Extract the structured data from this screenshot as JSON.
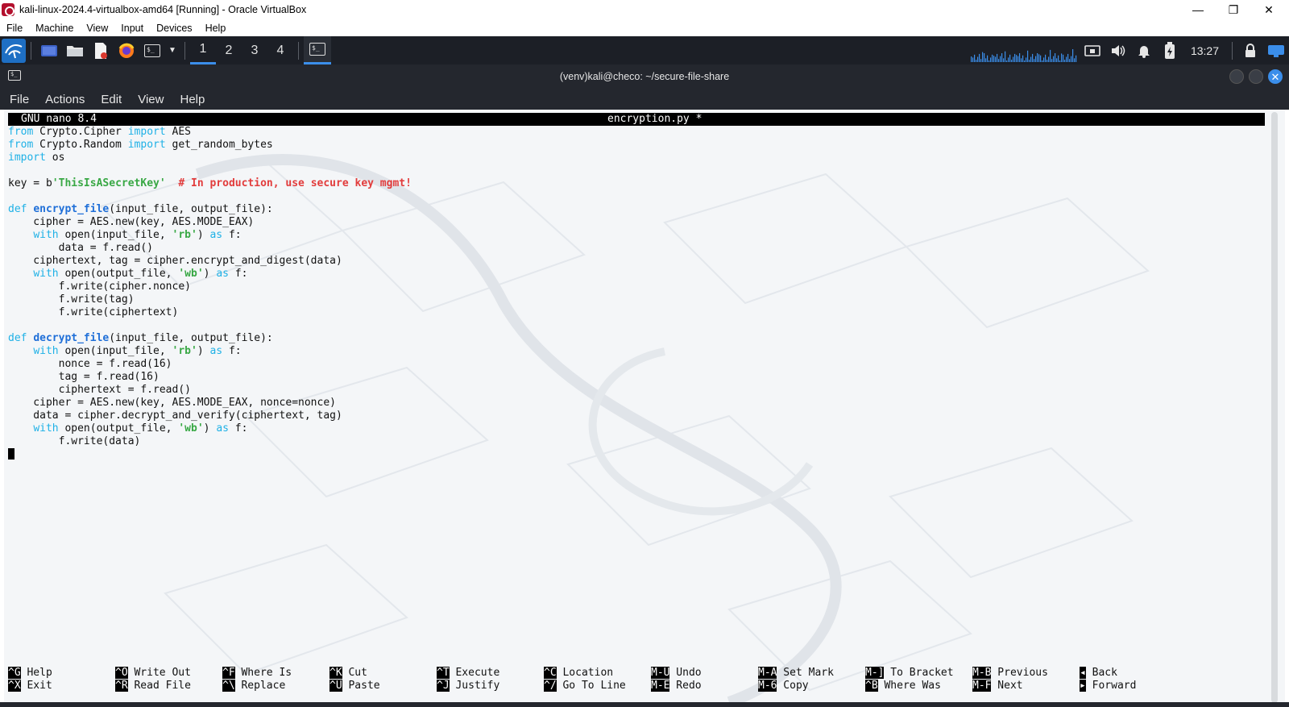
{
  "host_window": {
    "title": "kali-linux-2024.4-virtualbox-amd64 [Running] - Oracle VirtualBox",
    "controls": {
      "minimize": "—",
      "restore": "❐",
      "close": "✕"
    },
    "menu": [
      "File",
      "Machine",
      "View",
      "Input",
      "Devices",
      "Help"
    ]
  },
  "panel": {
    "workspaces": [
      "1",
      "2",
      "3",
      "4"
    ],
    "active_workspace": "1",
    "clock": "13:27",
    "icons": [
      "kali-menu-icon",
      "desktop-icon",
      "file-manager-icon",
      "text-editor-icon",
      "firefox-icon",
      "terminal-icon",
      "network-icon",
      "volume-icon",
      "notifications-icon",
      "battery-icon",
      "lock-icon",
      "vm-icon"
    ]
  },
  "terminal": {
    "title": "(venv)kali@checo: ~/secure-file-share",
    "menu": [
      "File",
      "Actions",
      "Edit",
      "View",
      "Help"
    ]
  },
  "nano": {
    "version": "GNU nano 8.4",
    "filename": "encryption.py *",
    "code_lines": [
      [
        {
          "t": "from",
          "c": "kw"
        },
        {
          "t": " Crypto.Cipher "
        },
        {
          "t": "import",
          "c": "kw"
        },
        {
          "t": " AES"
        }
      ],
      [
        {
          "t": "from",
          "c": "kw"
        },
        {
          "t": " Crypto.Random "
        },
        {
          "t": "import",
          "c": "kw"
        },
        {
          "t": " get_random_bytes"
        }
      ],
      [
        {
          "t": "import",
          "c": "kw"
        },
        {
          "t": " os"
        }
      ],
      [],
      [
        {
          "t": "key = b"
        },
        {
          "t": "'ThisIsASecretKey'",
          "c": "str"
        },
        {
          "t": "  "
        },
        {
          "t": "# In production, use secure key mgmt!",
          "c": "cm"
        }
      ],
      [],
      [
        {
          "t": "def",
          "c": "kw"
        },
        {
          "t": " "
        },
        {
          "t": "encrypt_file",
          "c": "fn"
        },
        {
          "t": "(input_file, output_file):"
        }
      ],
      [
        {
          "t": "    cipher = AES.new(key, AES.MODE_EAX)"
        }
      ],
      [
        {
          "t": "    "
        },
        {
          "t": "with",
          "c": "kw"
        },
        {
          "t": " open(input_file, "
        },
        {
          "t": "'rb'",
          "c": "str"
        },
        {
          "t": ") "
        },
        {
          "t": "as",
          "c": "kw"
        },
        {
          "t": " f:"
        }
      ],
      [
        {
          "t": "        data = f.read()"
        }
      ],
      [
        {
          "t": "    ciphertext, tag = cipher.encrypt_and_digest(data)"
        }
      ],
      [
        {
          "t": "    "
        },
        {
          "t": "with",
          "c": "kw"
        },
        {
          "t": " open(output_file, "
        },
        {
          "t": "'wb'",
          "c": "str"
        },
        {
          "t": ") "
        },
        {
          "t": "as",
          "c": "kw"
        },
        {
          "t": " f:"
        }
      ],
      [
        {
          "t": "        f.write(cipher.nonce)"
        }
      ],
      [
        {
          "t": "        f.write(tag)"
        }
      ],
      [
        {
          "t": "        f.write(ciphertext)"
        }
      ],
      [],
      [
        {
          "t": "def",
          "c": "kw"
        },
        {
          "t": " "
        },
        {
          "t": "decrypt_file",
          "c": "fn"
        },
        {
          "t": "(input_file, output_file):"
        }
      ],
      [
        {
          "t": "    "
        },
        {
          "t": "with",
          "c": "kw"
        },
        {
          "t": " open(input_file, "
        },
        {
          "t": "'rb'",
          "c": "str"
        },
        {
          "t": ") "
        },
        {
          "t": "as",
          "c": "kw"
        },
        {
          "t": " f:"
        }
      ],
      [
        {
          "t": "        nonce = f.read(16)"
        }
      ],
      [
        {
          "t": "        tag = f.read(16)"
        }
      ],
      [
        {
          "t": "        ciphertext = f.read()"
        }
      ],
      [
        {
          "t": "    cipher = AES.new(key, AES.MODE_EAX, nonce=nonce)"
        }
      ],
      [
        {
          "t": "    data = cipher.decrypt_and_verify(ciphertext, tag)"
        }
      ],
      [
        {
          "t": "    "
        },
        {
          "t": "with",
          "c": "kw"
        },
        {
          "t": " open(output_file, "
        },
        {
          "t": "'wb'",
          "c": "str"
        },
        {
          "t": ") "
        },
        {
          "t": "as",
          "c": "kw"
        },
        {
          "t": " f:"
        }
      ],
      [
        {
          "t": "        f.write(data)"
        }
      ]
    ],
    "shortcuts": [
      {
        "key": "^G",
        "label": "Help"
      },
      {
        "key": "^X",
        "label": "Exit"
      },
      {
        "key": "^O",
        "label": "Write Out"
      },
      {
        "key": "^R",
        "label": "Read File"
      },
      {
        "key": "^F",
        "label": "Where Is"
      },
      {
        "key": "^\\",
        "label": "Replace"
      },
      {
        "key": "^K",
        "label": "Cut"
      },
      {
        "key": "^U",
        "label": "Paste"
      },
      {
        "key": "^T",
        "label": "Execute"
      },
      {
        "key": "^J",
        "label": "Justify"
      },
      {
        "key": "^C",
        "label": "Location"
      },
      {
        "key": "^/",
        "label": "Go To Line"
      },
      {
        "key": "M-U",
        "label": "Undo"
      },
      {
        "key": "M-E",
        "label": "Redo"
      },
      {
        "key": "M-A",
        "label": "Set Mark"
      },
      {
        "key": "M-6",
        "label": "Copy"
      },
      {
        "key": "M-]",
        "label": "To Bracket"
      },
      {
        "key": "^B",
        "label": "Where Was"
      },
      {
        "key": "M-B",
        "label": "Previous"
      },
      {
        "key": "M-F",
        "label": "Next"
      },
      {
        "key": "◂",
        "label": "Back"
      },
      {
        "key": "▸",
        "label": "Forward"
      }
    ]
  },
  "colors": {
    "panel_bg": "#1c1f26",
    "terminal_chrome": "#24272e",
    "accent": "#3b8eea",
    "keyword": "#1fb1e6",
    "function": "#1f6fd8",
    "string": "#39a845",
    "comment": "#e23c3c"
  }
}
